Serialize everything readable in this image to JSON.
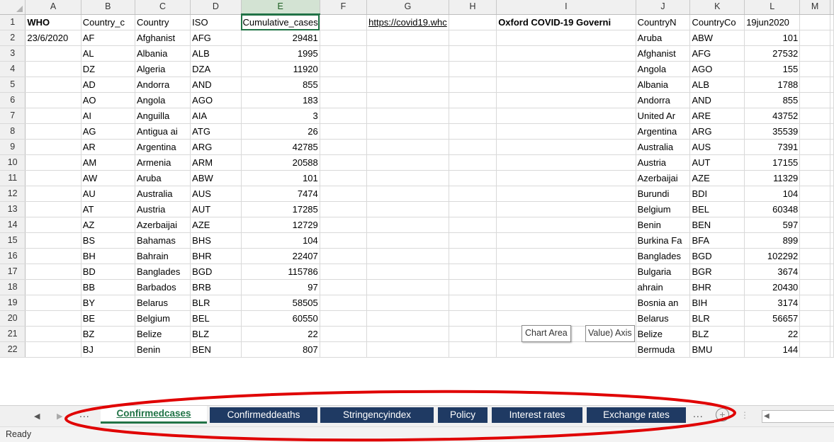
{
  "columns": [
    "A",
    "B",
    "C",
    "D",
    "E",
    "F",
    "G",
    "H",
    "I",
    "J",
    "K",
    "L",
    "M"
  ],
  "rows": [
    {
      "n": "1",
      "A": "WHO",
      "B": "Country_c",
      "C": "Country",
      "D": "ISO",
      "E": "Cumulative_cases",
      "G": "https://covid19.whc",
      "I": "Oxford COVID-19 Governi",
      "J": "CountryN",
      "K": "CountryCo",
      "L": "19jun2020"
    },
    {
      "n": "2",
      "A": "23/6/2020",
      "B": "AF",
      "C": "Afghanist",
      "D": "AFG",
      "E": "29481",
      "J": "Aruba",
      "K": "ABW",
      "L": "101"
    },
    {
      "n": "3",
      "B": "AL",
      "C": "Albania",
      "D": "ALB",
      "E": "1995",
      "J": "Afghanist",
      "K": "AFG",
      "L": "27532"
    },
    {
      "n": "4",
      "B": "DZ",
      "C": "Algeria",
      "D": "DZA",
      "E": "11920",
      "J": "Angola",
      "K": "AGO",
      "L": "155"
    },
    {
      "n": "5",
      "B": "AD",
      "C": "Andorra",
      "D": "AND",
      "E": "855",
      "J": "Albania",
      "K": "ALB",
      "L": "1788"
    },
    {
      "n": "6",
      "B": "AO",
      "C": "Angola",
      "D": "AGO",
      "E": "183",
      "J": "Andorra",
      "K": "AND",
      "L": "855"
    },
    {
      "n": "7",
      "B": "AI",
      "C": "Anguilla",
      "D": "AIA",
      "E": "3",
      "J": "United Ar",
      "K": "ARE",
      "L": "43752"
    },
    {
      "n": "8",
      "B": "AG",
      "C": "Antigua ai",
      "D": "ATG",
      "E": "26",
      "J": "Argentina",
      "K": "ARG",
      "L": "35539"
    },
    {
      "n": "9",
      "B": "AR",
      "C": "Argentina",
      "D": "ARG",
      "E": "42785",
      "J": "Australia",
      "K": "AUS",
      "L": "7391"
    },
    {
      "n": "10",
      "B": "AM",
      "C": "Armenia",
      "D": "ARM",
      "E": "20588",
      "J": "Austria",
      "K": "AUT",
      "L": "17155"
    },
    {
      "n": "11",
      "B": "AW",
      "C": "Aruba",
      "D": "ABW",
      "E": "101",
      "J": "Azerbaijai",
      "K": "AZE",
      "L": "11329"
    },
    {
      "n": "12",
      "B": "AU",
      "C": "Australia",
      "D": "AUS",
      "E": "7474",
      "J": "Burundi",
      "K": "BDI",
      "L": "104"
    },
    {
      "n": "13",
      "B": "AT",
      "C": "Austria",
      "D": "AUT",
      "E": "17285",
      "J": "Belgium",
      "K": "BEL",
      "L": "60348"
    },
    {
      "n": "14",
      "B": "AZ",
      "C": "Azerbaijai",
      "D": "AZE",
      "E": "12729",
      "J": "Benin",
      "K": "BEN",
      "L": "597"
    },
    {
      "n": "15",
      "B": "BS",
      "C": "Bahamas",
      "D": "BHS",
      "E": "104",
      "J": "Burkina Fa",
      "K": "BFA",
      "L": "899"
    },
    {
      "n": "16",
      "B": "BH",
      "C": "Bahrain",
      "D": "BHR",
      "E": "22407",
      "J": "Banglades",
      "K": "BGD",
      "L": "102292"
    },
    {
      "n": "17",
      "B": "BD",
      "C": "Banglades",
      "D": "BGD",
      "E": "115786",
      "J": "Bulgaria",
      "K": "BGR",
      "L": "3674"
    },
    {
      "n": "18",
      "B": "BB",
      "C": "Barbados",
      "D": "BRB",
      "E": "97",
      "J": "ahrain",
      "K": "BHR",
      "L": "20430"
    },
    {
      "n": "19",
      "B": "BY",
      "C": "Belarus",
      "D": "BLR",
      "E": "58505",
      "J": "Bosnia an",
      "K": "BIH",
      "L": "3174"
    },
    {
      "n": "20",
      "B": "BE",
      "C": "Belgium",
      "D": "BEL",
      "E": "60550",
      "J": "Belarus",
      "K": "BLR",
      "L": "56657"
    },
    {
      "n": "21",
      "B": "BZ",
      "C": "Belize",
      "D": "BLZ",
      "E": "22",
      "J": "Belize",
      "K": "BLZ",
      "L": "22"
    },
    {
      "n": "22",
      "B": "BJ",
      "C": "Benin",
      "D": "BEN",
      "E": "807",
      "J": "Bermuda",
      "K": "BMU",
      "L": "144"
    }
  ],
  "tooltip": {
    "chart_area": "Chart Area",
    "axis": "Value) Axis"
  },
  "tabs": {
    "ellipsis_left": "...",
    "items": [
      {
        "label": "Confirmedcases",
        "active": true
      },
      {
        "label": "Confirmeddeaths"
      },
      {
        "label": "Stringencyindex"
      },
      {
        "label": "Policy"
      },
      {
        "label": "Interest rates"
      },
      {
        "label": "Exchange rates"
      }
    ],
    "ellipsis_right": "...",
    "add_symbol": "+"
  },
  "status": {
    "text": "Ready"
  },
  "colors": {
    "accent": "#217346",
    "tab_bg": "#1f3a63",
    "annotation": "#e00000"
  }
}
